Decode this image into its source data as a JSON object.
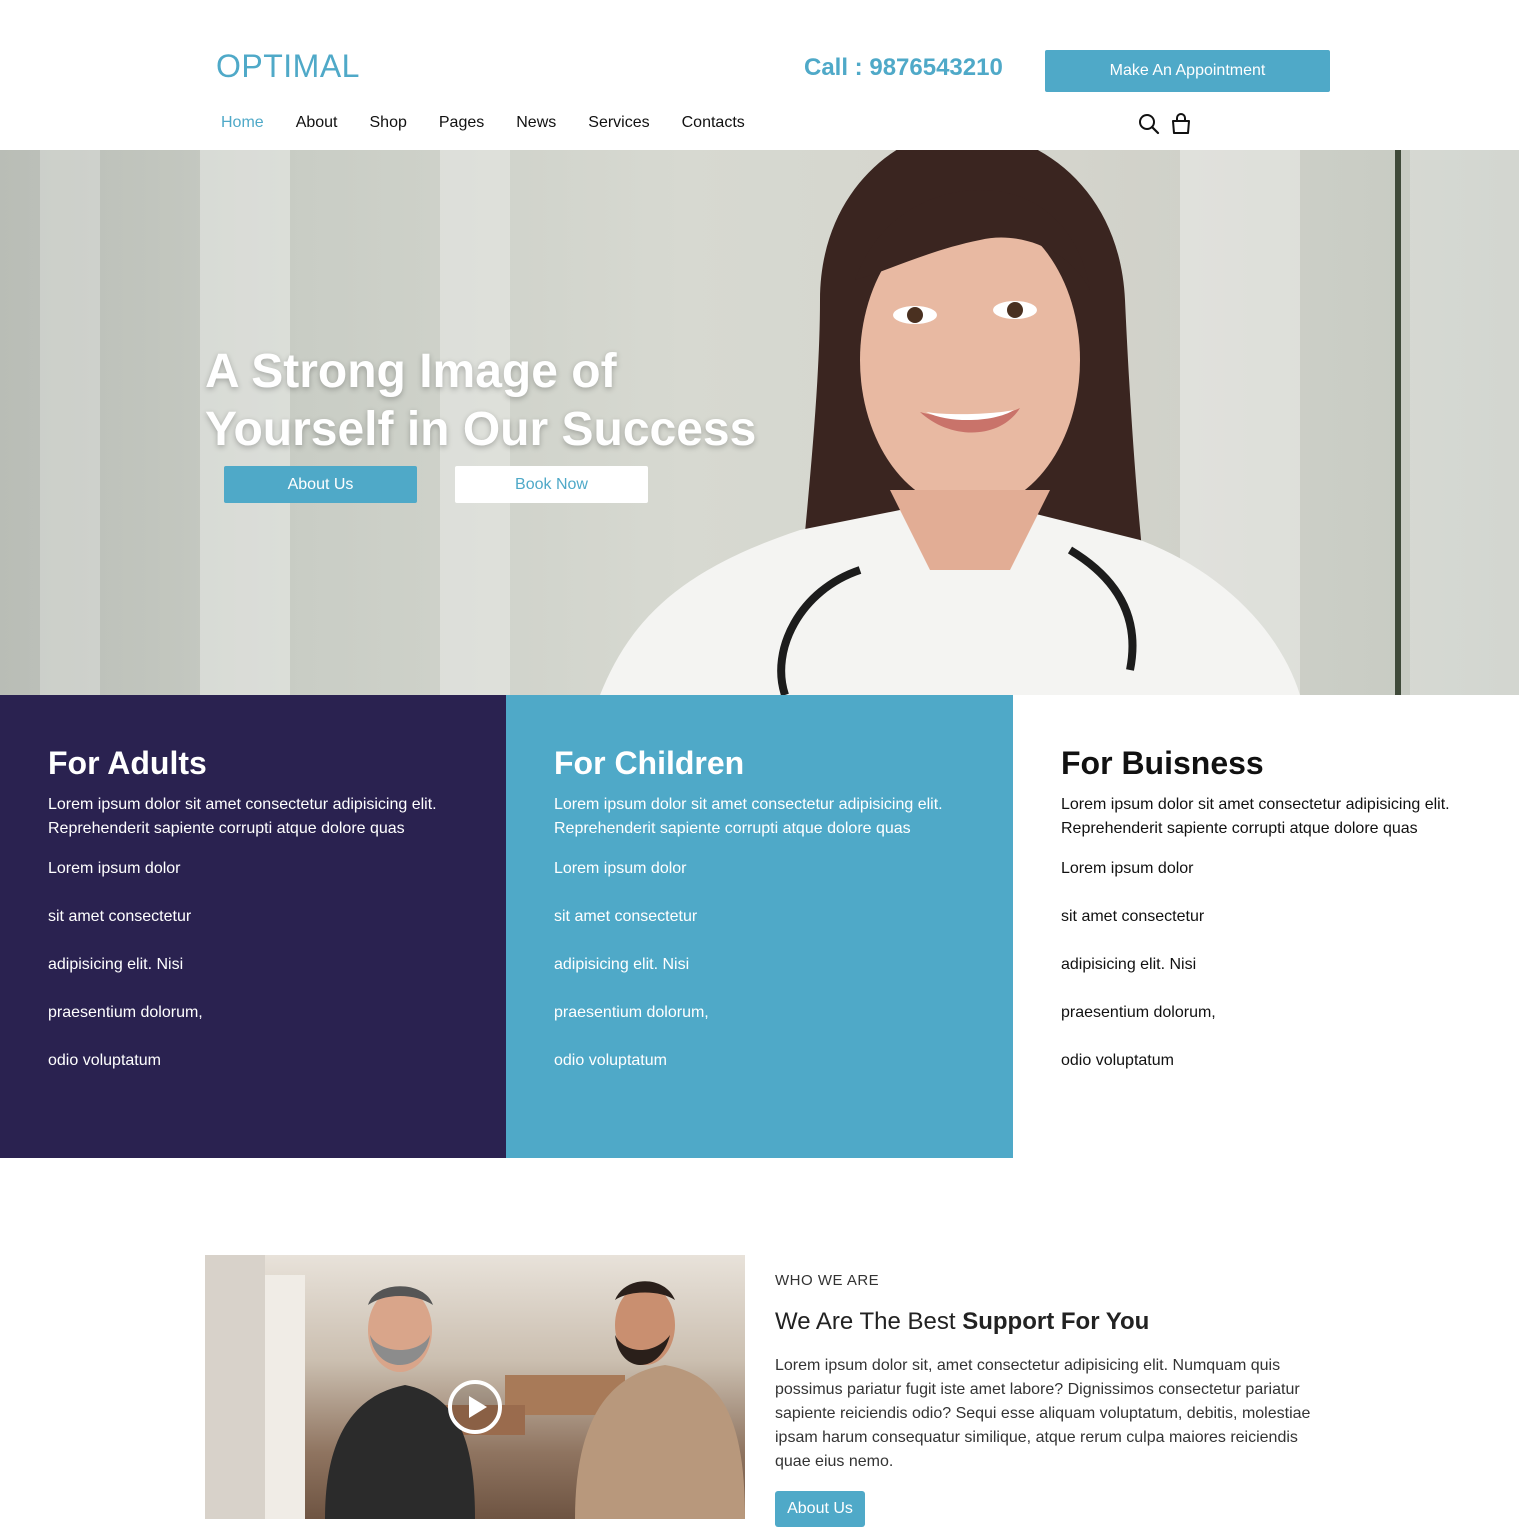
{
  "brand": {
    "logo": "OPTIMAL",
    "accent_color": "#4fa9c8",
    "dark_color": "#2a2250"
  },
  "header": {
    "call_prefix": "Call : ",
    "phone": "9876543210",
    "appointment_label": "Make An Appointment",
    "search_icon": "search-icon",
    "cart_icon": "shopping-bag-icon"
  },
  "nav": {
    "items": [
      {
        "label": "Home",
        "active": true
      },
      {
        "label": "About"
      },
      {
        "label": "Shop"
      },
      {
        "label": "Pages"
      },
      {
        "label": "News"
      },
      {
        "label": "Services"
      },
      {
        "label": "Contacts"
      }
    ]
  },
  "hero": {
    "title_line1": "A Strong Image of",
    "title_line2": "Yourself in Our Success",
    "primary_button": "About Us",
    "secondary_button": "Book Now"
  },
  "columns": [
    {
      "title": "For Adults",
      "description": "Lorem ipsum dolor sit amet consectetur adipisicing elit. Reprehenderit sapiente corrupti atque dolore quas",
      "items": [
        "Lorem ipsum dolor",
        "sit amet consectetur",
        "adipisicing elit. Nisi",
        "praesentium dolorum,",
        "odio voluptatum"
      ]
    },
    {
      "title": "For Children",
      "description": "Lorem ipsum dolor sit amet consectetur adipisicing elit. Reprehenderit sapiente corrupti atque dolore quas",
      "items": [
        "Lorem ipsum dolor",
        "sit amet consectetur",
        "adipisicing elit. Nisi",
        "praesentium dolorum,",
        "odio voluptatum"
      ]
    },
    {
      "title": "For Buisness",
      "description": "Lorem ipsum dolor sit amet consectetur adipisicing elit. Reprehenderit sapiente corrupti atque dolore quas",
      "items": [
        "Lorem ipsum dolor",
        "sit amet consectetur",
        "adipisicing elit. Nisi",
        "praesentium dolorum,",
        "odio voluptatum"
      ]
    }
  ],
  "who_we_are": {
    "label": "WHO WE ARE",
    "title_regular": "We Are The Best ",
    "title_bold": "Support For You",
    "text": "Lorem ipsum dolor sit, amet consectetur adipisicing elit. Numquam quis possimus pariatur fugit iste amet labore? Dignissimos consectetur pariatur sapiente reiciendis odio? Sequi esse aliquam voluptatum, debitis, molestiae ipsam harum consequatur similique, atque rerum culpa maiores reiciendis quae eius nemo.",
    "button": "About Us",
    "play_icon": "play-icon"
  }
}
